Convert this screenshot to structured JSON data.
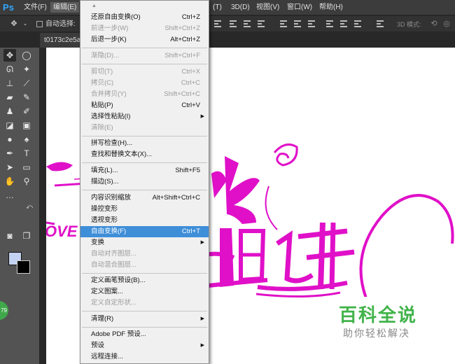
{
  "app": {
    "logo": "Ps"
  },
  "menubar": {
    "items": [
      {
        "label": "文件(F)"
      },
      {
        "label": "编辑(E)"
      },
      {
        "label": "(T)"
      },
      {
        "label": "3D(D)"
      },
      {
        "label": "视图(V)"
      },
      {
        "label": "窗口(W)"
      },
      {
        "label": "帮助(H)"
      }
    ]
  },
  "options_bar": {
    "auto_select_label": "自动选择:",
    "mode_3d_label": "3D 模式:"
  },
  "document": {
    "tab_title": "t0173c2e5a"
  },
  "tools": {
    "badge": "79"
  },
  "edit_menu": {
    "items": [
      {
        "label": "还原自由变换(O)",
        "shortcut": "Ctrl+Z"
      },
      {
        "label": "前进一步(W)",
        "shortcut": "Shift+Ctrl+Z"
      },
      {
        "label": "后退一步(K)",
        "shortcut": "Alt+Ctrl+Z"
      },
      {
        "label": "渐隐(D)...",
        "shortcut": "Shift+Ctrl+F"
      },
      {
        "label": "剪切(T)",
        "shortcut": "Ctrl+X"
      },
      {
        "label": "拷贝(C)",
        "shortcut": "Ctrl+C"
      },
      {
        "label": "合并拷贝(Y)",
        "shortcut": "Shift+Ctrl+C"
      },
      {
        "label": "粘贴(P)",
        "shortcut": "Ctrl+V"
      },
      {
        "label": "选择性粘贴(I)",
        "shortcut": ""
      },
      {
        "label": "清除(E)",
        "shortcut": ""
      },
      {
        "label": "拼写检查(H)...",
        "shortcut": ""
      },
      {
        "label": "查找和替换文本(X)...",
        "shortcut": ""
      },
      {
        "label": "填充(L)...",
        "shortcut": "Shift+F5"
      },
      {
        "label": "描边(S)...",
        "shortcut": ""
      },
      {
        "label": "内容识别缩放",
        "shortcut": "Alt+Shift+Ctrl+C"
      },
      {
        "label": "操控变形",
        "shortcut": ""
      },
      {
        "label": "透视变形",
        "shortcut": ""
      },
      {
        "label": "自由变换(F)",
        "shortcut": "Ctrl+T"
      },
      {
        "label": "变换",
        "shortcut": ""
      },
      {
        "label": "自动对齐图层...",
        "shortcut": ""
      },
      {
        "label": "自动混合图层...",
        "shortcut": ""
      },
      {
        "label": "定义画笔预设(B)...",
        "shortcut": ""
      },
      {
        "label": "定义图案...",
        "shortcut": ""
      },
      {
        "label": "定义自定形状...",
        "shortcut": ""
      },
      {
        "label": "清理(R)",
        "shortcut": ""
      },
      {
        "label": "Adobe PDF 预设...",
        "shortcut": ""
      },
      {
        "label": "预设",
        "shortcut": ""
      },
      {
        "label": "远程连接...",
        "shortcut": ""
      }
    ]
  },
  "artwork": {
    "text_fragment": "OVE",
    "color": "#e010c8"
  },
  "watermark": {
    "title": "百科全说",
    "subtitle": "助你轻松解决",
    "color": "#41b34a"
  }
}
